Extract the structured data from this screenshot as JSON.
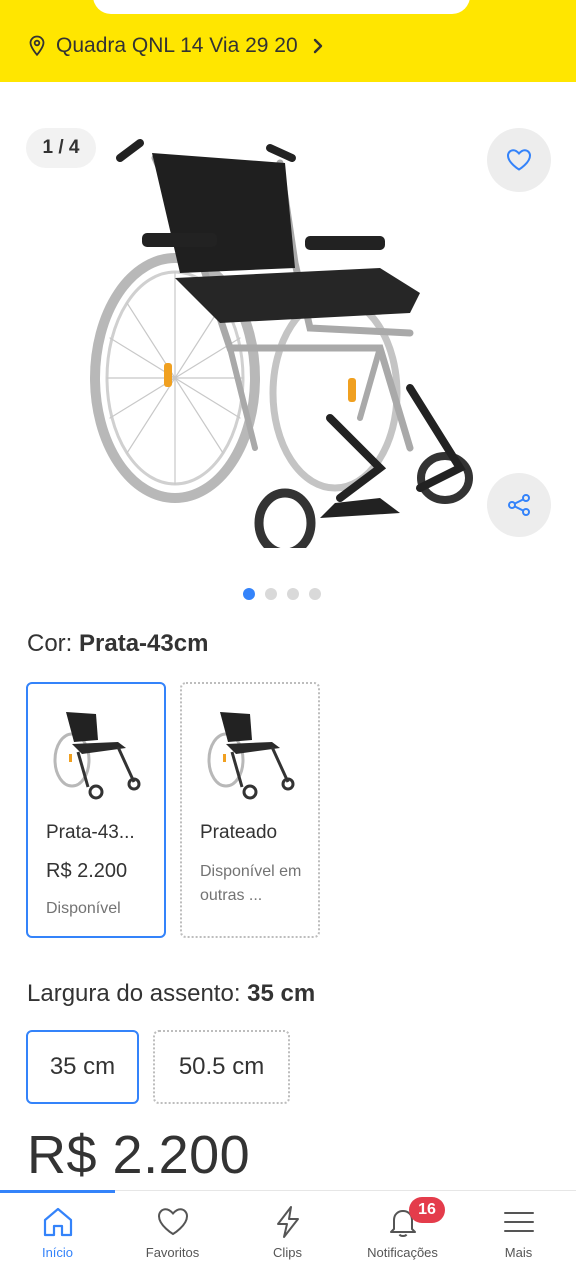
{
  "header": {
    "address": "Quadra QNL 14 Via 29 20"
  },
  "gallery": {
    "counter": "1 / 4",
    "image_count": 4,
    "active_index": 0
  },
  "variants": {
    "color_label": "Cor:",
    "color_value": "Prata-43cm",
    "options": [
      {
        "name": "Prata-43...",
        "price": "R$ 2.200",
        "status": "Disponível"
      },
      {
        "name": "Prateado",
        "availability": "Disponível em outras ..."
      }
    ],
    "width_label": "Largura do assento:",
    "width_value": "35 cm",
    "sizes": [
      "35 cm",
      "50.5 cm"
    ]
  },
  "price": "R$ 2.200",
  "bottom_nav": {
    "items": [
      {
        "label": "Início",
        "icon": "home-icon"
      },
      {
        "label": "Favoritos",
        "icon": "heart-icon"
      },
      {
        "label": "Clips",
        "icon": "bolt-icon"
      },
      {
        "label": "Notificações",
        "icon": "bell-icon",
        "badge": "16"
      },
      {
        "label": "Mais",
        "icon": "menu-icon"
      }
    ]
  },
  "colors": {
    "header_yellow": "#FFE600",
    "accent_blue": "#3483FA",
    "badge_red": "#E43C4B"
  }
}
